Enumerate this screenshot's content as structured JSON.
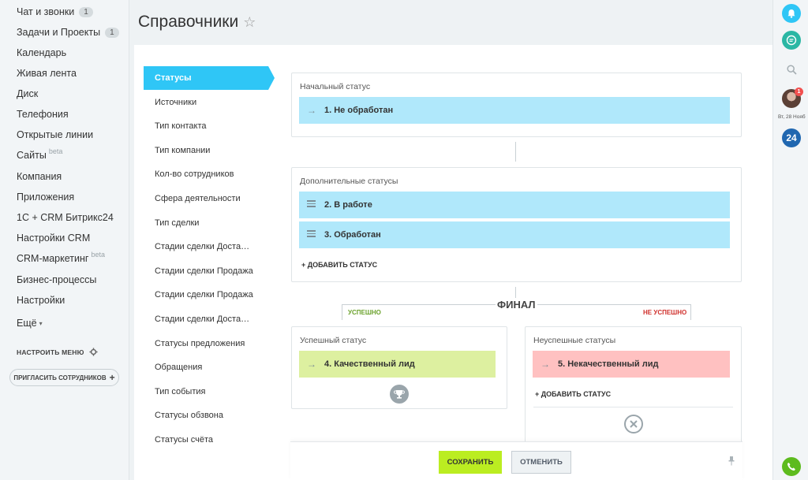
{
  "sidebar": {
    "items": [
      {
        "label": "Чат и звонки",
        "badge": "1"
      },
      {
        "label": "Задачи и Проекты",
        "badge": "1"
      },
      {
        "label": "Календарь"
      },
      {
        "label": "Живая лента"
      },
      {
        "label": "Диск"
      },
      {
        "label": "Телефония"
      },
      {
        "label": "Открытые линии"
      },
      {
        "label": "Сайты",
        "sup": "beta"
      },
      {
        "label": "Компания"
      },
      {
        "label": "Приложения"
      },
      {
        "label": "1С + CRM Битрикс24"
      },
      {
        "label": "Настройки CRM"
      },
      {
        "label": "CRM-маркетинг",
        "sup": "beta"
      },
      {
        "label": "Бизнес-процессы"
      },
      {
        "label": "Настройки"
      },
      {
        "label": "Ещё"
      }
    ],
    "configure_menu": "НАСТРОИТЬ МЕНЮ",
    "invite": "ПРИГЛАСИТЬ СОТРУДНИКОВ"
  },
  "page": {
    "title": "Справочники",
    "star": "☆"
  },
  "dictionaries": {
    "active": "Статусы",
    "items": [
      "Источники",
      "Тип контакта",
      "Тип компании",
      "Кол-во сотрудников",
      "Сфера деятельности",
      "Тип сделки",
      "Стадии сделки Доставка",
      "Стадии сделки Продажа",
      "Стадии сделки Продажа",
      "Стадии сделки Доставка",
      "Статусы предложения",
      "Обращения",
      "Тип события",
      "Статусы обзвона",
      "Статусы счёта"
    ]
  },
  "initial": {
    "title": "Начальный статус",
    "status": "1. Не обработан"
  },
  "additional": {
    "title": "Дополнительные статусы",
    "statuses": [
      "2. В работе",
      "3. Обработан"
    ],
    "add": "+ ДОБАВИТЬ СТАТУС"
  },
  "final": {
    "label": "ФИНАЛ",
    "success_tab": "УСПЕШНО",
    "fail_tab": "НЕ УСПЕШНО"
  },
  "success": {
    "title": "Успешный статус",
    "status": "4. Качественный лид"
  },
  "fail": {
    "title": "Неуспешные статусы",
    "status": "5. Некачественный лид",
    "add": "+ ДОБАВИТЬ СТАТУС"
  },
  "footer": {
    "save": "СОХРАНИТЬ",
    "cancel": "ОТМЕНИТЬ"
  },
  "rightbar": {
    "avatar_badge": "1",
    "date": "Вт, 28 Нояб",
    "logo": "24"
  },
  "colors": {
    "accent": "#2fc6f6",
    "save": "#bbed21",
    "status_blue": "#b0e8fb",
    "status_green": "#ddf0a0",
    "status_red": "#ffc1c1"
  }
}
